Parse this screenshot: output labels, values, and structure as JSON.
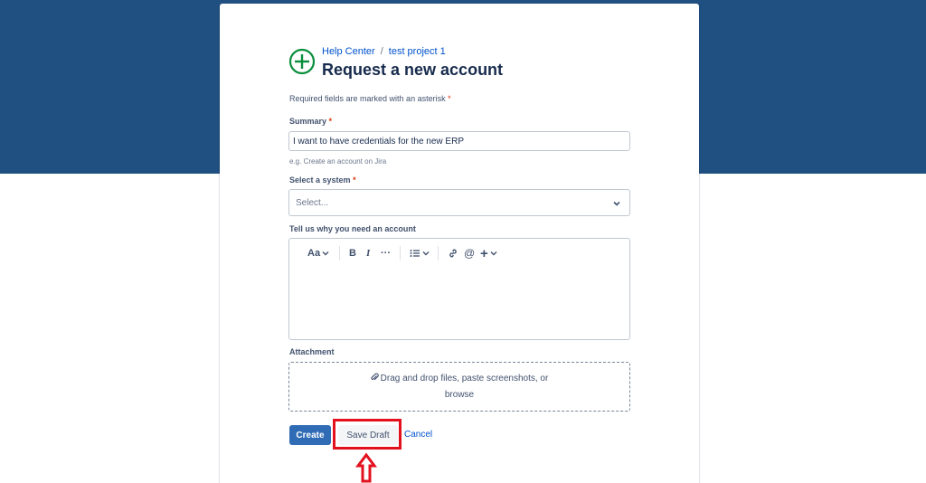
{
  "header": {
    "breadcrumb": [
      "Help Center",
      "test project 1"
    ],
    "breadcrumb_separator": "/",
    "title": "Request a new account",
    "icon": "plus-circle-icon",
    "icon_color": "#0a8f3d"
  },
  "form": {
    "required_note": "Required fields are marked with an asterisk",
    "asterisk": "*",
    "summary": {
      "label": "Summary",
      "value": "I want to have credentials for the new ERP",
      "hint": "e.g. Create an account on Jira"
    },
    "system": {
      "label": "Select a system",
      "placeholder": "Select..."
    },
    "reason": {
      "label": "Tell us why you need an account",
      "toolbar": {
        "text_style": "Aa",
        "bold": "B",
        "italic": "I",
        "more": "···",
        "list_icon": "bullet-list-icon",
        "link_icon": "link-icon",
        "mention": "@",
        "insert": "+"
      }
    },
    "attachment": {
      "label": "Attachment",
      "line1": "Drag and drop files, paste screenshots, or",
      "line2": "browse"
    }
  },
  "actions": {
    "create": "Create",
    "save_draft": "Save Draft",
    "cancel": "Cancel"
  },
  "colors": {
    "banner": "#205081",
    "primary": "#2f6cb5",
    "highlight": "#e3101d"
  }
}
